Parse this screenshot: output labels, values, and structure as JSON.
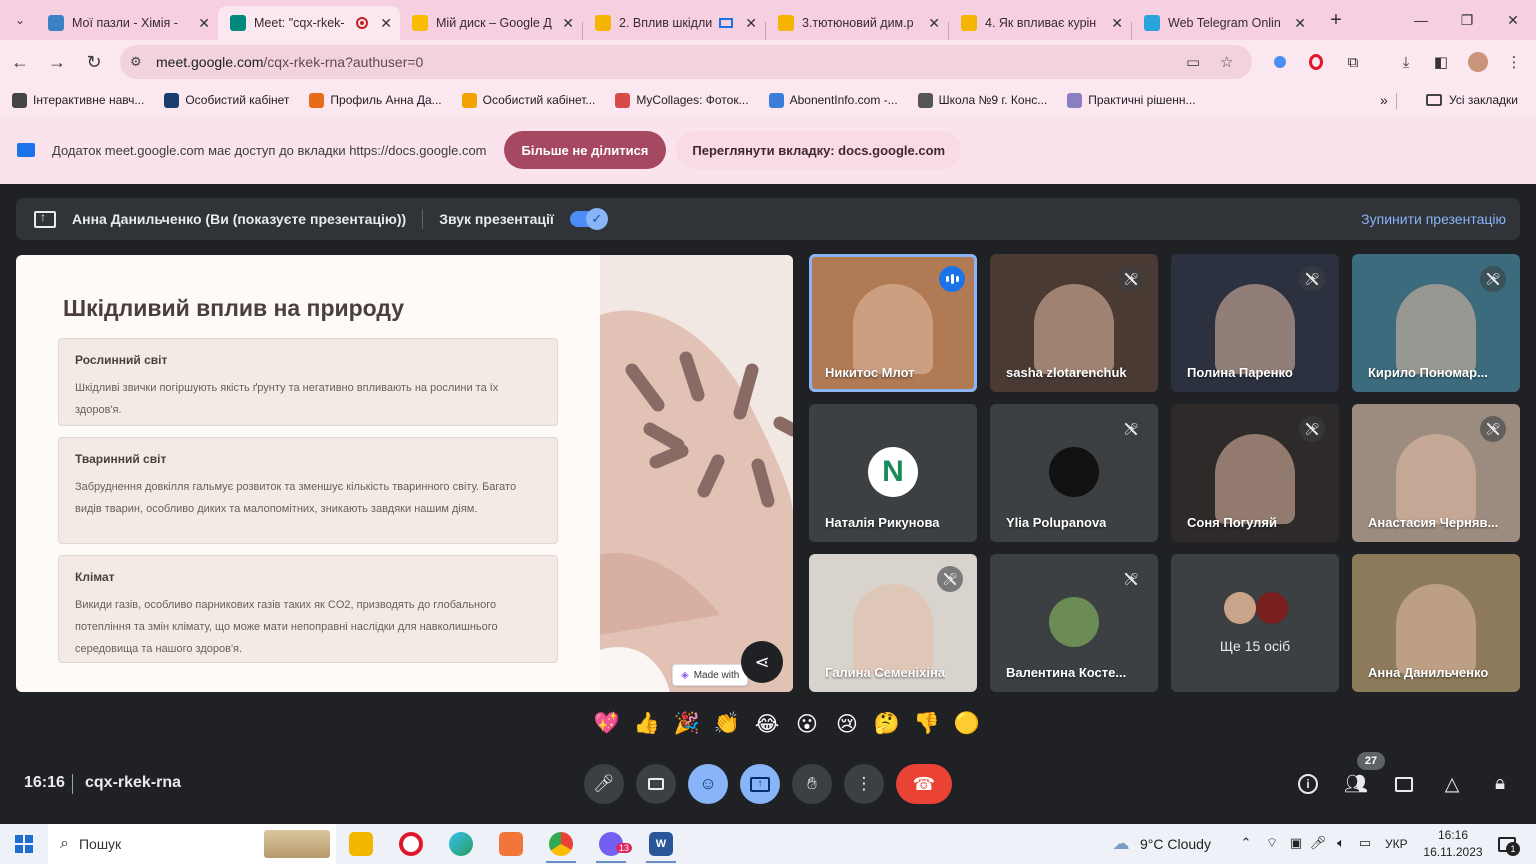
{
  "browser": {
    "tabs": [
      {
        "title": "Мої пазли - Хімія - ",
        "fav_color": "#3b82c4",
        "active": false
      },
      {
        "title": "Meet: \"cqx-rkek-",
        "fav_color": "#00897b",
        "active": true
      },
      {
        "title": "Мій диск – Google Д",
        "fav_color": "#fbbc04",
        "active": false
      },
      {
        "title": "2. Вплив шкідли",
        "fav_color": "#f4b400",
        "active": false
      },
      {
        "title": "3.тютюновий дим.р",
        "fav_color": "#f4b400",
        "active": false
      },
      {
        "title": "4. Як впливає курін",
        "fav_color": "#f4b400",
        "active": false
      },
      {
        "title": "Web Telegram Onlin",
        "fav_color": "#2aa3de",
        "active": false
      }
    ],
    "url_host": "meet.google.com",
    "url_path": "/cqx-rkek-rna?authuser=0",
    "bookmarks": [
      {
        "label": "Інтерактивне навч...",
        "color": "#444444"
      },
      {
        "label": "Особистий кабінет",
        "color": "#1a3c6e"
      },
      {
        "label": "Профиль Анна Да...",
        "color": "#e86b1c"
      },
      {
        "label": "Особистий кабінет...",
        "color": "#f1a300"
      },
      {
        "label": "MyCollages: Фоток...",
        "color": "#d84a4a"
      },
      {
        "label": "AbonentInfo.com -...",
        "color": "#3b7dd8"
      },
      {
        "label": "Школа №9 г. Конс...",
        "color": "#555555"
      },
      {
        "label": "Практичні рішенн...",
        "color": "#8a7fc0"
      }
    ],
    "all_bookmarks": "Усі закладки",
    "share_notice": "Додаток meet.google.com має доступ до вкладки https://docs.google.com",
    "stop_sharing": "Більше не ділитися",
    "view_tab": "Переглянути вкладку: docs.google.com"
  },
  "meet": {
    "presenter": "Анна Данильченко (Ви (показуєте презентацію))",
    "audio_label": "Звук презентації",
    "stop_presenting": "Зупинити презентацію",
    "slide": {
      "title": "Шкідливий вплив на природу",
      "cards": [
        {
          "heading": "Рослинний  світ",
          "text": "Шкідливі звички погіршують якість ґрунту та негативно впливають на рослини та їх здоров'я."
        },
        {
          "heading": "Тваринний світ",
          "text": "Забруднення довкілля гальмує розвиток та зменшує кількість тваринного світу. Багато видів тварин, особливо диких та малопомітних, зникають завдяки нашим діям."
        },
        {
          "heading": "Клімат",
          "text": "Викиди газів, особливо парникових газів таких як CO2, призводять до глобального потепління та змін клімату, що може мати непоправні наслідки для навколишнього середовища та нашого здоров'я."
        }
      ],
      "made_with": "Made with"
    },
    "participants": [
      {
        "name": "Никитос Млот",
        "bg": "#b07a55",
        "speaking": true
      },
      {
        "name": "sasha zlotarenchuk",
        "bg": "#4a3a34",
        "muted": true
      },
      {
        "name": "Полина Паренко",
        "bg": "#2c3140",
        "muted": true
      },
      {
        "name": "Кирило Пономар...",
        "bg": "#3b6b7d",
        "muted": true
      },
      {
        "name": "Наталія Рикунова",
        "bg": "#3c4043",
        "avatar": "N"
      },
      {
        "name": "Ylia Polupanova",
        "bg": "#3c4043",
        "muted": true
      },
      {
        "name": "Соня Погуляй",
        "bg": "#2e2a2a",
        "muted": true
      },
      {
        "name": "Анастасия Черняв...",
        "bg": "#9c8c80",
        "muted": true
      },
      {
        "name": "Галина Семеніхіна",
        "bg": "#d8d3cc",
        "muted": true
      },
      {
        "name": "Валентина Косте...",
        "bg": "#3c4043",
        "muted": true
      },
      {
        "name": "",
        "bg": "#3c4043",
        "more": "Ще 15 осіб"
      },
      {
        "name": "Анна Данильченко",
        "bg": "#8c7a5a"
      }
    ],
    "reactions": [
      "💖",
      "👍",
      "🎉",
      "👏",
      "😂",
      "😮",
      "😢",
      "🤔",
      "👎",
      "🟡"
    ],
    "time": "16:16",
    "meeting_code": "cqx-rkek-rna",
    "people_count": "27"
  },
  "taskbar": {
    "search_placeholder": "Пошук",
    "weather": "9°C  Cloudy",
    "lang": "УКР",
    "time": "16:16",
    "date": "16.11.2023",
    "notif_count": "1",
    "viber_badge": "13"
  },
  "colors": {
    "meet_bg": "#202124",
    "accent": "#8ab4f8",
    "hangup": "#ea4335",
    "chrome_pink": "#fbe7ef"
  }
}
